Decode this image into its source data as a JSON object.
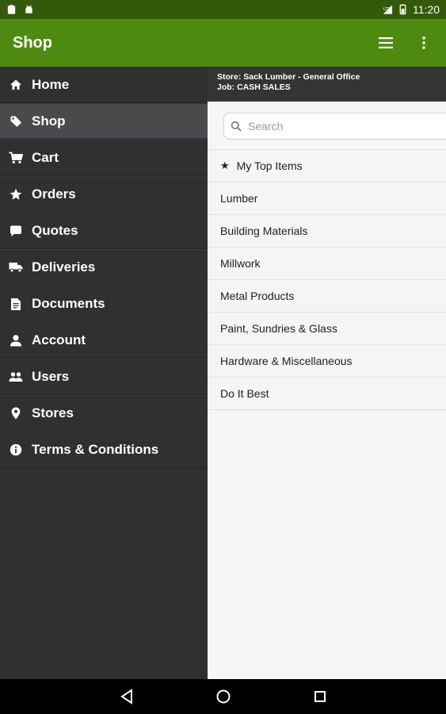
{
  "status_bar": {
    "time": "11:20"
  },
  "app_bar": {
    "title": "Shop"
  },
  "sidebar": {
    "items": [
      {
        "label": "Home",
        "icon": "home-icon"
      },
      {
        "label": "Shop",
        "icon": "tag-icon"
      },
      {
        "label": "Cart",
        "icon": "cart-icon"
      },
      {
        "label": "Orders",
        "icon": "star-icon"
      },
      {
        "label": "Quotes",
        "icon": "chat-bubble-icon"
      },
      {
        "label": "Deliveries",
        "icon": "truck-icon"
      },
      {
        "label": "Documents",
        "icon": "document-icon"
      },
      {
        "label": "Account",
        "icon": "person-icon"
      },
      {
        "label": "Users",
        "icon": "users-icon"
      },
      {
        "label": "Stores",
        "icon": "map-pin-icon"
      },
      {
        "label": "Terms & Conditions",
        "icon": "info-icon"
      }
    ]
  },
  "store_info": {
    "store": "Store: Sack Lumber - General Office",
    "job": "Job: CASH SALES"
  },
  "search": {
    "placeholder": "Search"
  },
  "categories": [
    "My Top Items",
    "Lumber",
    "Building Materials",
    "Millwork",
    "Metal Products",
    "Paint, Sundries & Glass",
    "Hardware & Miscellaneous",
    "Do It Best"
  ],
  "colors": {
    "app_bar": "#4f8a10",
    "status_bar": "#33590a",
    "sidebar": "#303030"
  }
}
